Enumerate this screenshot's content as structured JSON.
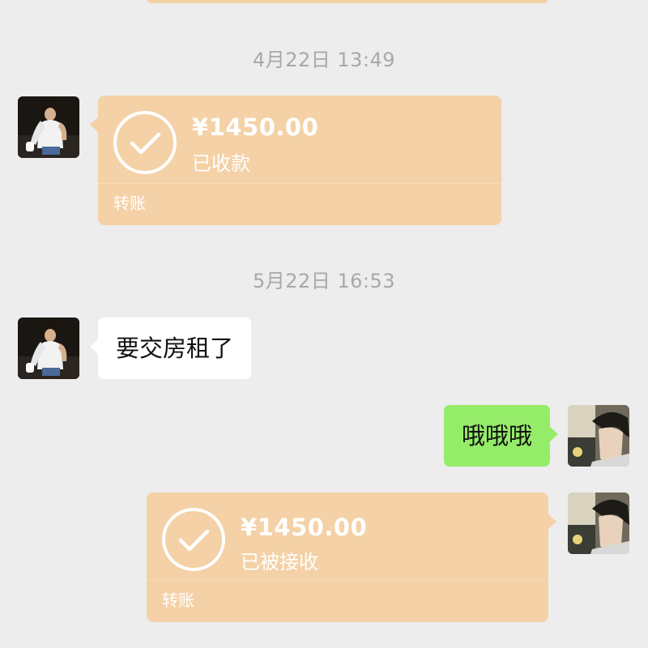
{
  "chat": {
    "messages": [
      {
        "kind": "timestamp",
        "text": "4月22日 13:49"
      },
      {
        "kind": "transfer",
        "side": "left",
        "amount": "¥1450.00",
        "status": "已收款",
        "label": "转账"
      },
      {
        "kind": "timestamp",
        "text": "5月22日 16:53"
      },
      {
        "kind": "text",
        "side": "left",
        "text": "要交房租了"
      },
      {
        "kind": "text",
        "side": "right",
        "text": "哦哦哦"
      },
      {
        "kind": "transfer",
        "side": "right",
        "amount": "¥1450.00",
        "status": "已被接收",
        "label": "转账"
      }
    ]
  },
  "colors": {
    "background": "#ededed",
    "transfer_card": "#f4d1a6",
    "sent_bubble": "#95ec69",
    "received_bubble": "#ffffff",
    "timestamp_text": "#a8a8a8"
  },
  "icons": {
    "transfer_status": "check-circle-icon",
    "avatar_left": "contact-avatar",
    "avatar_right": "self-avatar"
  }
}
